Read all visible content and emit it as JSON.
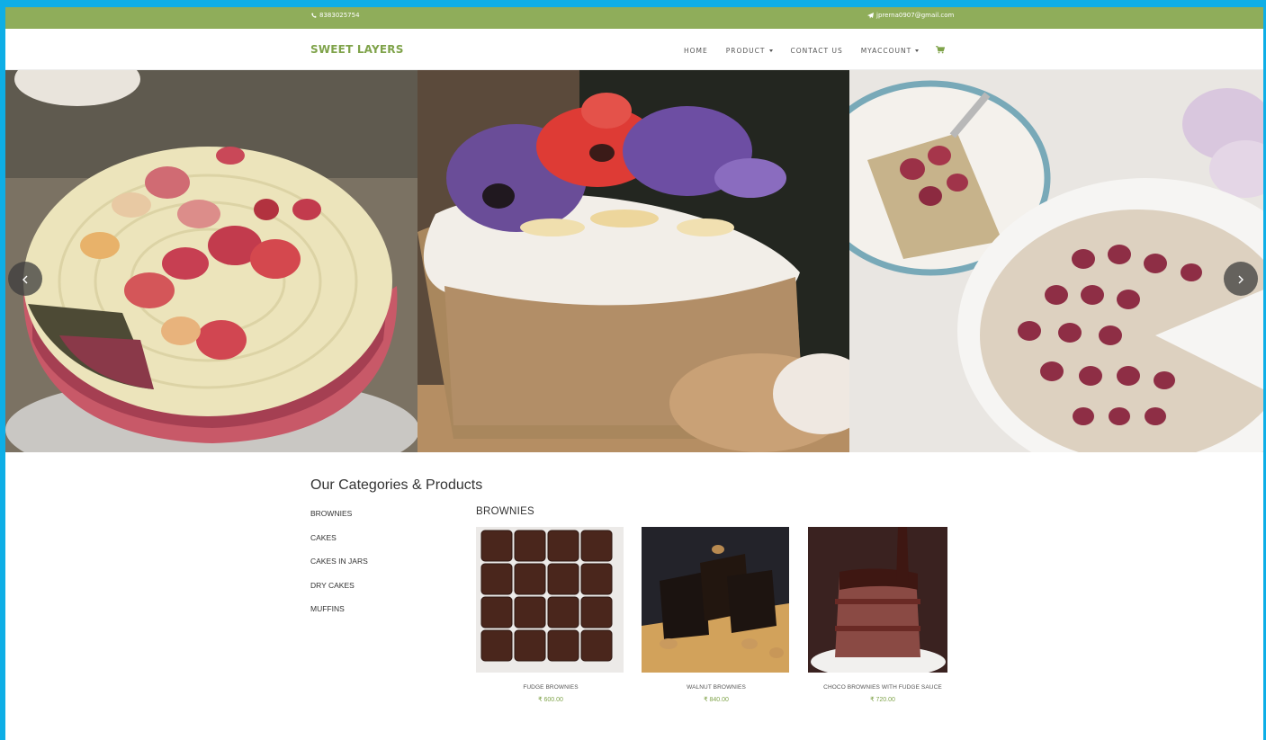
{
  "topbar": {
    "phone_icon": "phone-icon",
    "phone": "8383025754",
    "email_icon": "paper-plane-icon",
    "email": "jprerna0907@gmail.com"
  },
  "navbar": {
    "brand": "SWEET LAYERS",
    "items": [
      {
        "label": "HOME",
        "dropdown": false
      },
      {
        "label": "PRODUCT",
        "dropdown": true
      },
      {
        "label": "CONTACT US",
        "dropdown": false
      },
      {
        "label": "MYACCOUNT",
        "dropdown": true
      }
    ],
    "cart_icon": "cart-icon"
  },
  "hero": {
    "slides": [
      "cake-with-sugared-petals",
      "banana-bread-with-flowers",
      "raspberry-cake-on-plate"
    ],
    "prev_icon": "chevron-left-icon",
    "next_icon": "chevron-right-icon"
  },
  "main": {
    "title": "Our Categories & Products",
    "categories": [
      "BROWNIES",
      "CAKES",
      "CAKES IN JARS",
      "DRY CAKES",
      "MUFFINS"
    ],
    "selected_category": "BROWNIES",
    "products": [
      {
        "name": "FUDGE BROWNIES",
        "price": "₹ 600.00"
      },
      {
        "name": "WALNUT BROWNIES",
        "price": "₹ 840.00"
      },
      {
        "name": "CHOCO BROWNIES WITH FUDGE SAUCE",
        "price": "₹ 720.00"
      }
    ]
  },
  "colors": {
    "accent": "#8fad5a",
    "brand": "#7fa34a",
    "frame": "#0eaee6"
  }
}
